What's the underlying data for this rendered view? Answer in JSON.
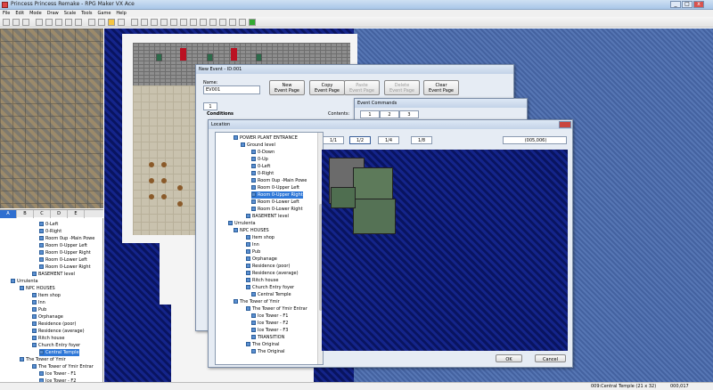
{
  "window": {
    "title": "Princess Princess Remake - RPG Maker VX Ace",
    "min": "_",
    "max": "□",
    "close": "x"
  },
  "menu": [
    "File",
    "Edit",
    "Mode",
    "Draw",
    "Scale",
    "Tools",
    "Game",
    "Help"
  ],
  "tileset_tabs": [
    "A",
    "B",
    "C",
    "D",
    "E"
  ],
  "map_tree": [
    {
      "label": "0-Left",
      "indent": 44,
      "sel": false
    },
    {
      "label": "0-Right",
      "indent": 44,
      "sel": false
    },
    {
      "label": "Room 0up -Main Powe",
      "indent": 44,
      "sel": false
    },
    {
      "label": "Room 0-Upper Left",
      "indent": 44,
      "sel": false
    },
    {
      "label": "Room 0-Upper Right",
      "indent": 44,
      "sel": false
    },
    {
      "label": "Room 0-Lower Left",
      "indent": 44,
      "sel": false
    },
    {
      "label": "Room 0-Lower Right",
      "indent": 44,
      "sel": false
    },
    {
      "label": "BASEMENT level",
      "indent": 36,
      "sel": false
    },
    {
      "label": "Urrulenta",
      "indent": 12,
      "sel": false
    },
    {
      "label": "NPC HOUSES",
      "indent": 22,
      "sel": false
    },
    {
      "label": "Item shop",
      "indent": 36,
      "sel": false
    },
    {
      "label": "Inn",
      "indent": 36,
      "sel": false
    },
    {
      "label": "Pub",
      "indent": 36,
      "sel": false
    },
    {
      "label": "Orphanage",
      "indent": 36,
      "sel": false
    },
    {
      "label": "Residence (poor)",
      "indent": 36,
      "sel": false
    },
    {
      "label": "Residence (average)",
      "indent": 36,
      "sel": false
    },
    {
      "label": "Ritch house",
      "indent": 36,
      "sel": false
    },
    {
      "label": "Church Entry foyer",
      "indent": 36,
      "sel": false
    },
    {
      "label": "Central Temple",
      "indent": 44,
      "sel": true
    },
    {
      "label": "The Tower of Ymir",
      "indent": 22,
      "sel": false
    },
    {
      "label": "The Tower of Ymir Entrar",
      "indent": 36,
      "sel": false
    },
    {
      "label": "Ice Tower - F1",
      "indent": 44,
      "sel": false
    },
    {
      "label": "Ice Tower - F2",
      "indent": 44,
      "sel": false
    }
  ],
  "event_dialog": {
    "title": "New Event - ID:001",
    "name_label": "Name:",
    "name_value": "EV001",
    "buttons": [
      "New\nEvent Page",
      "Copy\nEvent Page",
      "Paste\nEvent Page",
      "Delete\nEvent Page",
      "Clear\nEvent Page"
    ],
    "page_tab": "1",
    "conditions": "Conditions",
    "contents": "Contents:"
  },
  "commands_dialog": {
    "title": "Event Commands",
    "tabs": [
      "1",
      "2",
      "3"
    ]
  },
  "location_dialog": {
    "title": "Location",
    "zoom_tabs": [
      "1/1",
      "1/2",
      "1/4",
      "1/8"
    ],
    "selected_zoom": 1,
    "coords": "(005,006)",
    "ok": "OK",
    "cancel": "Cancel"
  },
  "location_tree": [
    {
      "label": "POWER PLANT ENTRANCE",
      "indent": 20,
      "sel": false
    },
    {
      "label": "Ground level",
      "indent": 28,
      "sel": false
    },
    {
      "label": "0-Down",
      "indent": 40,
      "sel": false
    },
    {
      "label": "0-Up",
      "indent": 40,
      "sel": false
    },
    {
      "label": "0-Left",
      "indent": 40,
      "sel": false
    },
    {
      "label": "0-Right",
      "indent": 40,
      "sel": false
    },
    {
      "label": "Room 0up -Main Powe",
      "indent": 40,
      "sel": false
    },
    {
      "label": "Room 0-Upper Left",
      "indent": 40,
      "sel": false
    },
    {
      "label": "Room 0-Upper Right",
      "indent": 40,
      "sel": true
    },
    {
      "label": "Room 0-Lower Left",
      "indent": 40,
      "sel": false
    },
    {
      "label": "Room 0-Lower Right",
      "indent": 40,
      "sel": false
    },
    {
      "label": "BASEMENT level",
      "indent": 34,
      "sel": false
    },
    {
      "label": "Urrulenta",
      "indent": 14,
      "sel": false
    },
    {
      "label": "NPC HOUSES",
      "indent": 20,
      "sel": false
    },
    {
      "label": "Item shop",
      "indent": 34,
      "sel": false
    },
    {
      "label": "Inn",
      "indent": 34,
      "sel": false
    },
    {
      "label": "Pub",
      "indent": 34,
      "sel": false
    },
    {
      "label": "Orphanage",
      "indent": 34,
      "sel": false
    },
    {
      "label": "Residence (poor)",
      "indent": 34,
      "sel": false
    },
    {
      "label": "Residence (average)",
      "indent": 34,
      "sel": false
    },
    {
      "label": "Ritch house",
      "indent": 34,
      "sel": false
    },
    {
      "label": "Church Entry foyer",
      "indent": 34,
      "sel": false
    },
    {
      "label": "Central Temple",
      "indent": 40,
      "sel": false
    },
    {
      "label": "The Tower of Ymir",
      "indent": 20,
      "sel": false
    },
    {
      "label": "The Tower of Ymir Entrar",
      "indent": 34,
      "sel": false
    },
    {
      "label": "Ice Tower - F1",
      "indent": 40,
      "sel": false
    },
    {
      "label": "Ice Tower - F2",
      "indent": 40,
      "sel": false
    },
    {
      "label": "Ice Tower - F3",
      "indent": 40,
      "sel": false
    },
    {
      "label": "TRANSITION",
      "indent": 40,
      "sel": false
    },
    {
      "label": "The Original",
      "indent": 34,
      "sel": false
    },
    {
      "label": "The Original",
      "indent": 40,
      "sel": false
    }
  ],
  "status": {
    "map": "009:Central Temple (21 x 32)",
    "coord": "000,017"
  }
}
